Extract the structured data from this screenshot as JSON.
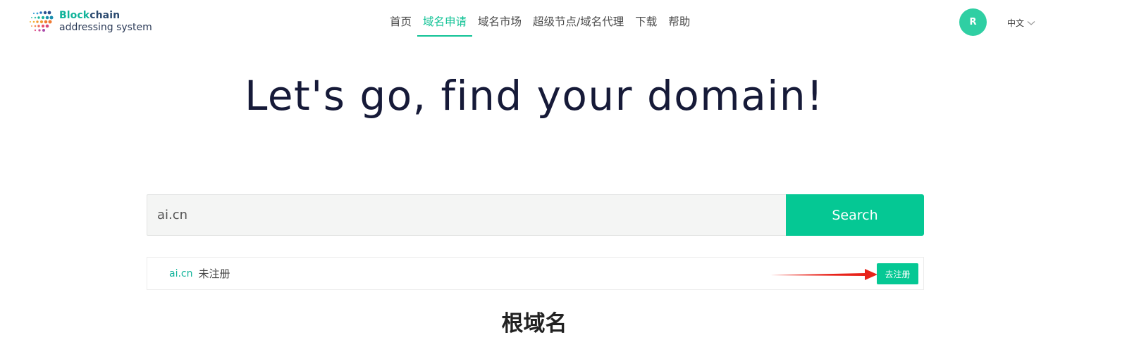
{
  "header": {
    "logo": {
      "line1_a": "Block",
      "line1_b": "chain",
      "line2": "addressing system"
    },
    "nav": [
      {
        "label": "首页",
        "active": false
      },
      {
        "label": "域名申请",
        "active": true
      },
      {
        "label": "域名市场",
        "active": false
      },
      {
        "label": "超级节点/域名代理",
        "active": false
      },
      {
        "label": "下载",
        "active": false
      },
      {
        "label": "帮助",
        "active": false
      }
    ],
    "avatar_initial": "R",
    "language": "中文"
  },
  "hero": {
    "title": "Let's go, find your domain!"
  },
  "search": {
    "value": "ai.cn",
    "button_label": "Search"
  },
  "result": {
    "domain": "ai.cn",
    "status": "未注册",
    "register_label": "去注册"
  },
  "section": {
    "title": "根域名"
  },
  "colors": {
    "accent": "#05c894",
    "nav_active": "#10c295",
    "title": "#161a38",
    "arrow": "#e8231a"
  }
}
